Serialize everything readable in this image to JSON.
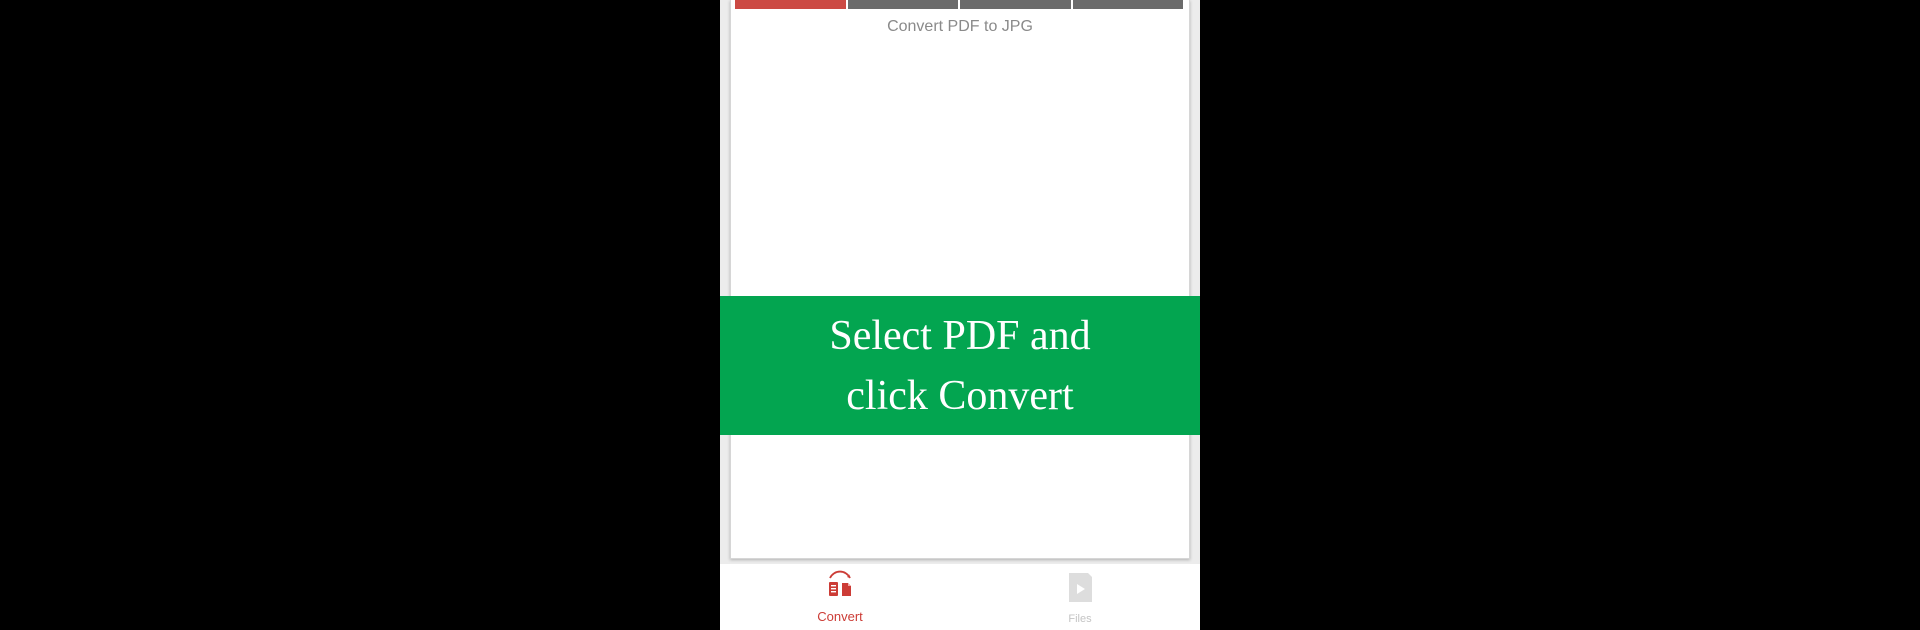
{
  "wizard": {
    "steps": [
      {
        "state": "active"
      },
      {
        "state": "inactive"
      },
      {
        "state": "inactive"
      },
      {
        "state": "inactive"
      }
    ],
    "step_title": "Convert PDF to JPG"
  },
  "banner": {
    "text": "Select PDF and\nclick Convert"
  },
  "bottom_nav": {
    "items": [
      {
        "label": "Convert",
        "icon": "convert-icon",
        "active": true
      },
      {
        "label": "Files",
        "icon": "files-icon",
        "active": false
      }
    ]
  },
  "colors": {
    "accent": "#cc3c36",
    "banner_green": "#03a550",
    "progress_inactive": "#6b6b6b"
  }
}
